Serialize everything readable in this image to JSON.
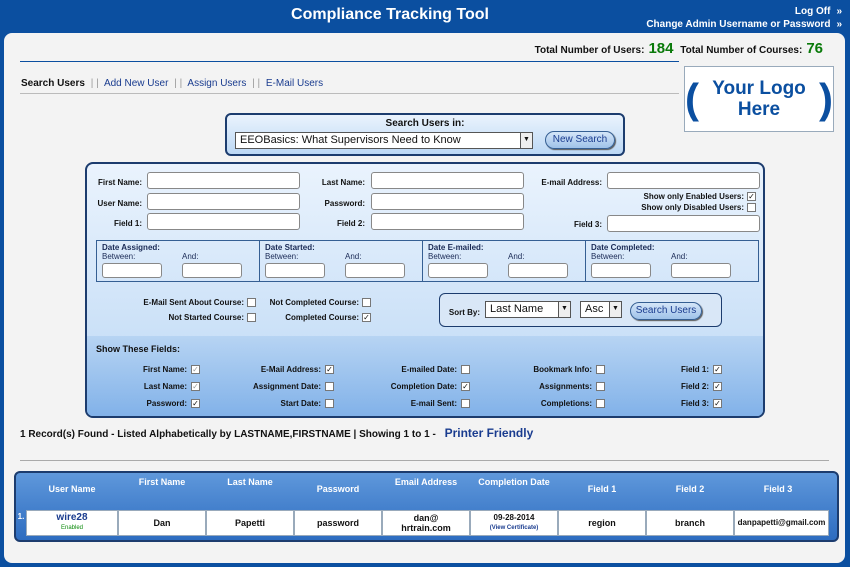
{
  "app_title": "Compliance Tracking Tool",
  "top_links": {
    "logoff": "Log Off",
    "change_admin": "Change Admin Username or Password",
    "arrow": "»"
  },
  "totals": {
    "users_label": "Total Number of Users:",
    "users": "184",
    "courses_label": "Total Number of Courses:",
    "courses": "76"
  },
  "nav": {
    "current": "Search Users",
    "sep": "| |",
    "add_user": "Add New User",
    "assign_users": "Assign Users",
    "email_users": "E-Mail Users"
  },
  "logo": {
    "open": "(",
    "text": "Your Logo Here",
    "close": ")"
  },
  "search_in": {
    "label": "Search Users in:",
    "course": "EEOBasics: What Supervisors Need to Know",
    "new_search": "New Search"
  },
  "form": {
    "first_name": "First Name:",
    "last_name": "Last Name:",
    "email": "E-mail Address:",
    "user_name": "User Name:",
    "password": "Password:",
    "field1": "Field 1:",
    "field2": "Field 2:",
    "field3": "Field 3:",
    "only_enabled": "Show only Enabled Users:",
    "only_disabled": "Show only Disabled Users:"
  },
  "dates": [
    {
      "title": "Date Assigned:",
      "between": "Between:",
      "and": "And:"
    },
    {
      "title": "Date Started:",
      "between": "Between:",
      "and": "And:"
    },
    {
      "title": "Date E-mailed:",
      "between": "Between:",
      "and": "And:"
    },
    {
      "title": "Date Completed:",
      "between": "Between:",
      "and": "And:"
    }
  ],
  "status": {
    "email_sent": "E-Mail Sent About Course:",
    "not_started": "Not Started Course:",
    "not_completed": "Not Completed Course:",
    "completed": "Completed Course:"
  },
  "sort": {
    "label": "Sort By:",
    "field": "Last Name",
    "order": "Asc",
    "button": "Search Users"
  },
  "show_fields": {
    "header": "Show These Fields:",
    "col1": [
      "First Name:",
      "Last Name:",
      "Password:"
    ],
    "col2": [
      "E-Mail Address:",
      "Assignment Date:",
      "Start Date:"
    ],
    "col3": [
      "E-mailed Date:",
      "Completion Date:",
      "E-mail Sent:"
    ],
    "col4": [
      "Bookmark Info:",
      "Assignments:",
      "Completions:"
    ],
    "col5": [
      "Field 1:",
      "Field 2:",
      "Field 3:"
    ],
    "checked_mark": "✓"
  },
  "records": {
    "text": "1 Record(s) Found - Listed Alphabetically by LASTNAME,FIRSTNAME | Showing 1 to 1 -",
    "printer": "Printer Friendly"
  },
  "table": {
    "headers": [
      "User Name",
      "First Name",
      "Last Name",
      "Password",
      "Email Address",
      "Completion Date",
      "Field 1",
      "Field 2",
      "Field 3"
    ],
    "row": {
      "num": "1.",
      "username": "wire28",
      "enabled": "Enabled",
      "first": "Dan",
      "last": "Papetti",
      "password": "password",
      "email1": "dan@",
      "email2": "hrtrain.com",
      "date": "09-28-2014",
      "cert": "View Certificate",
      "field1": "region",
      "field2": "branch",
      "field3": "danpapetti@gmail.com"
    }
  }
}
